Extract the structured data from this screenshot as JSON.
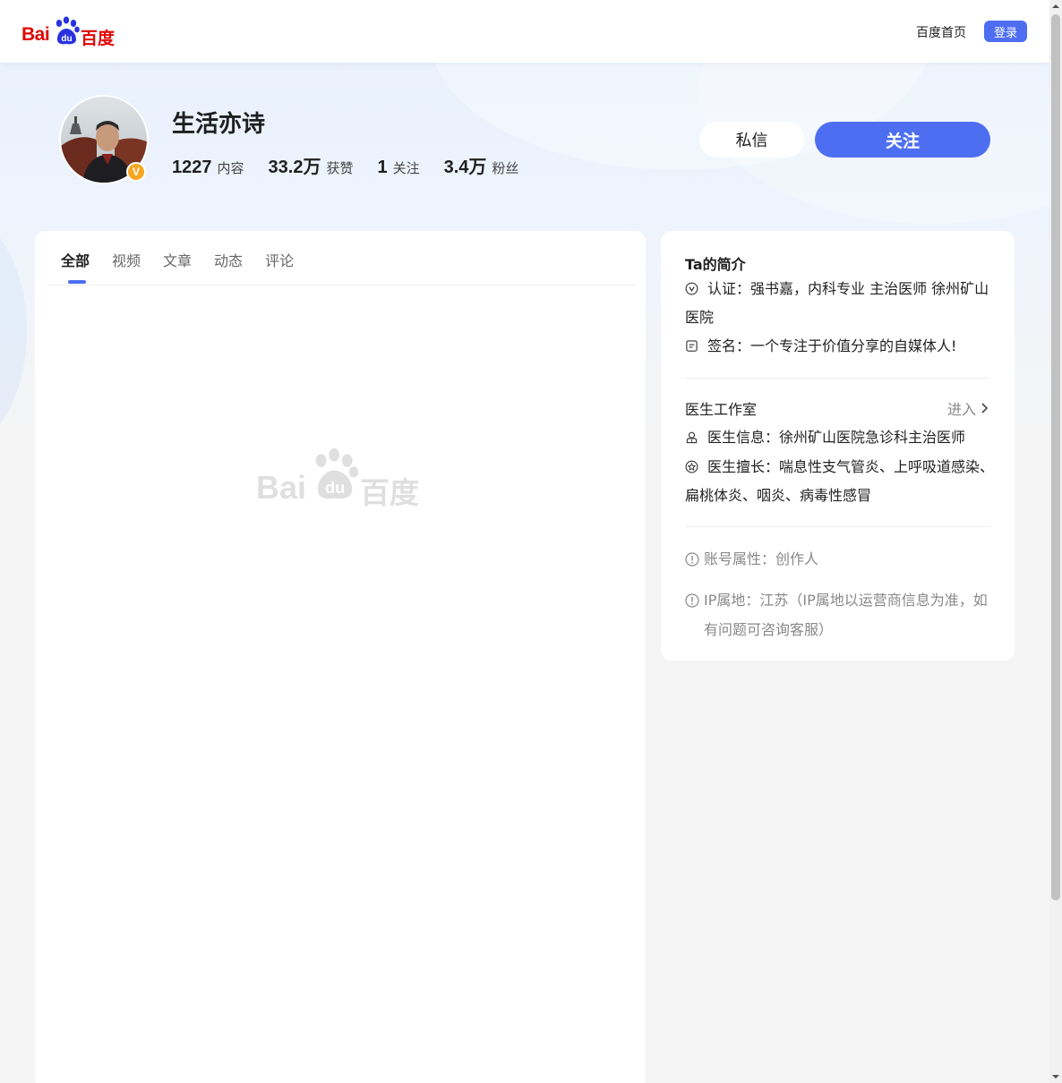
{
  "header": {
    "logo_latin": "Bai",
    "logo_du": "du",
    "logo_cn": "百度",
    "home_link": "百度首页",
    "login_label": "登录"
  },
  "profile": {
    "name": "生活亦诗",
    "verified_badge": "V",
    "stats": [
      {
        "value": "1227",
        "label": "内容"
      },
      {
        "value": "33.2万",
        "label": "获赞"
      },
      {
        "value": "1",
        "label": "关注"
      },
      {
        "value": "3.4万",
        "label": "粉丝"
      }
    ],
    "message_label": "私信",
    "follow_label": "关注"
  },
  "tabs": [
    {
      "label": "全部",
      "active": true
    },
    {
      "label": "视频",
      "active": false
    },
    {
      "label": "文章",
      "active": false
    },
    {
      "label": "动态",
      "active": false
    },
    {
      "label": "评论",
      "active": false
    }
  ],
  "placeholder": {
    "latin": "Bai",
    "du": "du",
    "cn": "百度"
  },
  "intro": {
    "title": "Ta的简介",
    "certification": "认证：强书嘉，内科专业 主治医师 徐州矿山医院",
    "signature": "签名：一个专注于价值分享的自媒体人!"
  },
  "studio": {
    "title": "医生工作室",
    "enter_label": "进入",
    "doctor_info": "医生信息：徐州矿山医院急诊科主治医师",
    "specialty": "医生擅长：喘息性支气管炎、上呼吸道感染、扁桃体炎、咽炎、病毒性感冒"
  },
  "account": {
    "type": "账号属性：创作人",
    "ip": "IP属地：江苏（IP属地以运营商信息为准，如有问题可咨询客服）"
  },
  "colors": {
    "brand_red": "#e10602",
    "accent_blue": "#4e6ef2",
    "badge_orange": "#f5a623"
  }
}
